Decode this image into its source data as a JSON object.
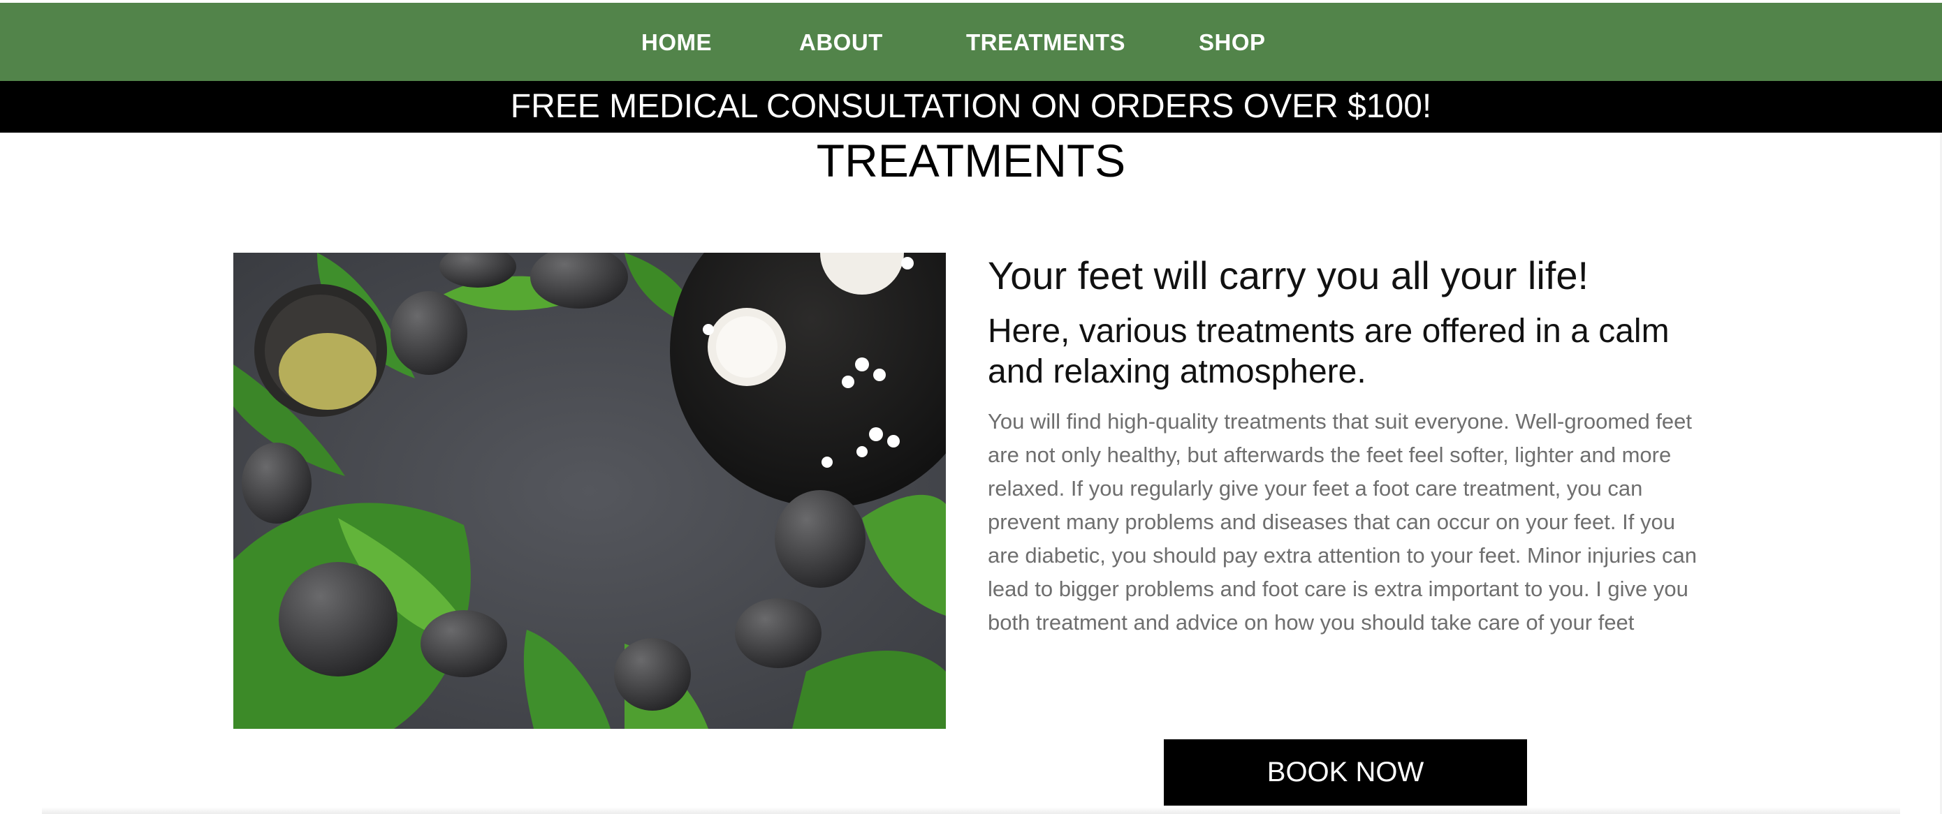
{
  "nav": {
    "items": [
      {
        "label": "HOME"
      },
      {
        "label": "ABOUT"
      },
      {
        "label": "TREATMENTS"
      },
      {
        "label": "SHOP"
      }
    ],
    "background": "#52844a"
  },
  "banner": {
    "text": "FREE MEDICAL CONSULTATION ON ORDERS OVER $100!"
  },
  "page": {
    "title": "TREATMENTS"
  },
  "content": {
    "heading": "Your feet will carry you all your life!",
    "subheading": "Here, various treatments are offered in a calm and relaxing atmosphere.",
    "body": "You will find high-quality treatments that suit everyone. Well-groomed feet are not only healthy, but afterwards the feet feel softer, lighter and more relaxed. If you regularly give your feet a foot care treatment, you can prevent many problems and diseases that can occur on your feet. If you are diabetic, you should pay extra attention to your feet. Minor injuries can lead to bigger problems and foot care is extra important to you. I give you both treatment and advice on how you should take care of your feet",
    "cta_label": "BOOK NOW"
  }
}
